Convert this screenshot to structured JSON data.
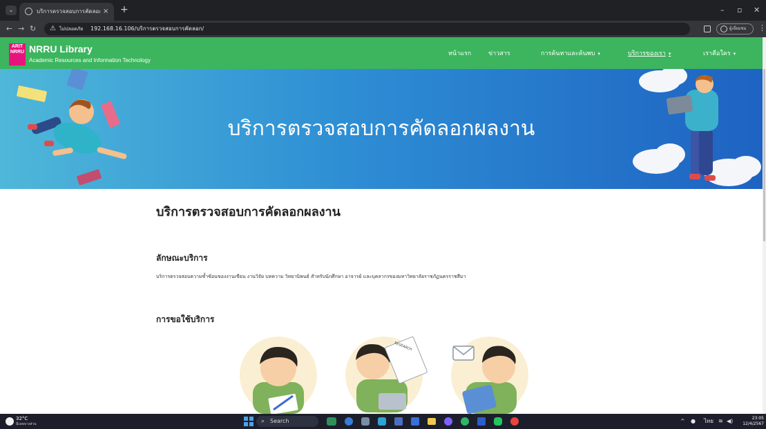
{
  "browser": {
    "tab_title": "บริการตรวจสอบการคัดลอกผลงาน...",
    "tab_close": "×",
    "new_tab": "+",
    "insecure_label": "ไม่ปลอดภัย",
    "url": "192.168.16.106/บริการตรวจสอบการคัดลอก/",
    "profile_label": "ผู้เยี่ยมชม",
    "icons": {
      "menu": "chevron-down-icon",
      "back": "back-arrow-icon",
      "forward": "forward-arrow-icon",
      "reload": "reload-icon",
      "warning": "warning-icon",
      "extension": "sidepanel-icon",
      "profile": "profile-icon",
      "more": "more-vertical-icon"
    }
  },
  "site": {
    "brand_logo": "ARIT NRRU",
    "brand_title": "NRRU Library",
    "brand_subtitle": "Academic Resources and Information Technology",
    "colors": {
      "nav": "#3cb55e",
      "logo": "#e7147e",
      "hero_start": "#4fb7d9",
      "hero_end": "#1e63c2"
    },
    "menu": [
      {
        "label": "หน้าแรก",
        "dropdown": false,
        "active": false
      },
      {
        "label": "ข่าวสาร",
        "dropdown": false,
        "active": false
      },
      {
        "label": "การค้นหาและค้นพบ",
        "dropdown": true,
        "active": false
      },
      {
        "label": "บริการของเรา",
        "dropdown": true,
        "active": true
      },
      {
        "label": "เราคือใคร",
        "dropdown": true,
        "active": false
      }
    ],
    "caret": "▾"
  },
  "hero": {
    "title": "บริการตรวจสอบการคัดลอกผลงาน",
    "decor": {
      "research_paper_text": "RESEARCH"
    }
  },
  "content": {
    "page_title": "บริการตรวจสอบการคัดลอกผลงาน",
    "section1_title": "ลักษณะบริการ",
    "section1_text": "บริการตรวจสอบความซ้ำซ้อนของงานเขียน งานวิจัย บทความ วิทยานิพนธ์ สำหรับนักศึกษา อาจารย์ และบุคลากรของมหาวิทยาลัยราชภัฏนครราชสีมา",
    "section2_title": "การขอใช้บริการ"
  },
  "taskbar": {
    "temperature": "32°C",
    "weather_desc": "มีเมฆบางส่วน",
    "search_label": "Search",
    "time": "23:05",
    "date": "12/4/2567",
    "lang": "ไทย",
    "tray_chevron": "^",
    "wifi": "wifi-icon",
    "volume": "volume-icon"
  }
}
